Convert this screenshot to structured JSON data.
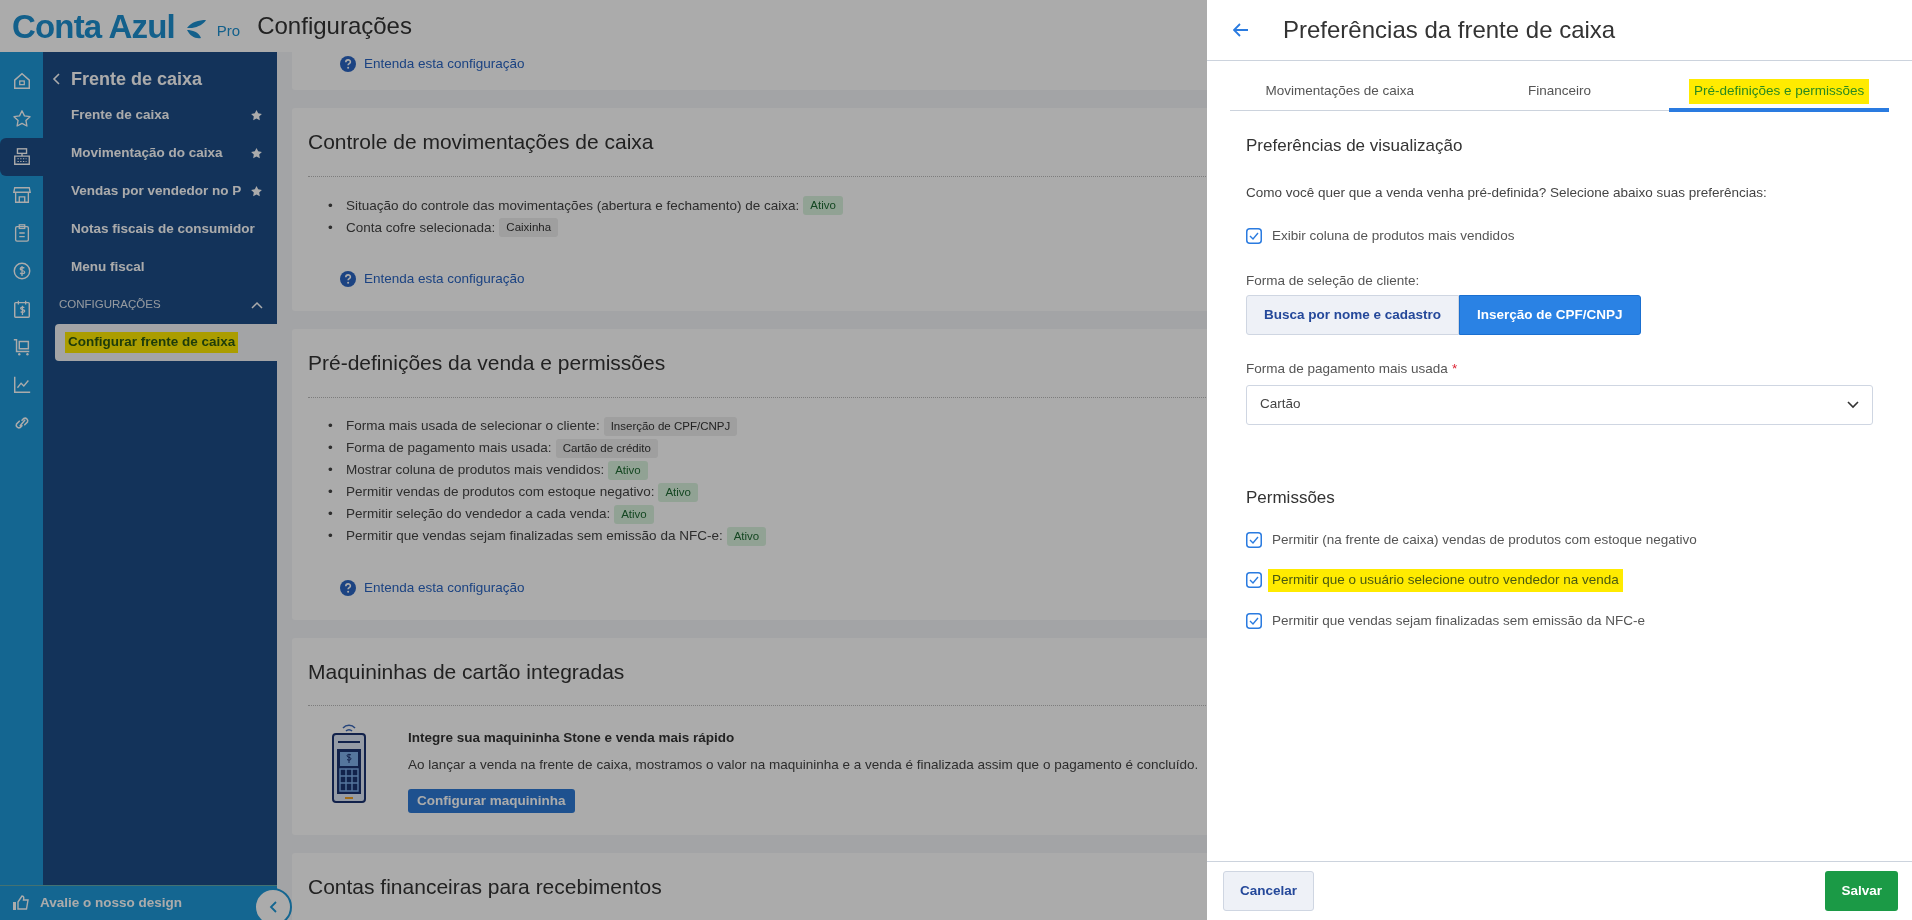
{
  "app": {
    "logo": "Conta Azul",
    "plan": "Pro",
    "page_title": "Configurações"
  },
  "rail": [
    {
      "kind": "home",
      "selected": false
    },
    {
      "kind": "star",
      "selected": false
    },
    {
      "kind": "register",
      "selected": true
    },
    {
      "kind": "store",
      "selected": false
    },
    {
      "kind": "clipboard",
      "selected": false
    },
    {
      "kind": "coin",
      "selected": false
    },
    {
      "kind": "calendar",
      "selected": false
    },
    {
      "kind": "cart",
      "selected": false
    },
    {
      "kind": "chart",
      "selected": false
    },
    {
      "kind": "link",
      "selected": false
    }
  ],
  "nav": {
    "back_title": "Frente de caixa",
    "items": [
      {
        "label": "Frente de caixa",
        "starred": true
      },
      {
        "label": "Movimentação do caixa",
        "starred": true
      },
      {
        "label": "Vendas por vendedor no P",
        "starred": true
      },
      {
        "label": "Notas fiscais de consumidor",
        "starred": false
      },
      {
        "label": "Menu fiscal",
        "starred": false
      }
    ],
    "section": {
      "label": "CONFIGURAÇÕES",
      "expanded": true,
      "items": [
        {
          "label": "Configurar frente de caixa",
          "selected": true,
          "highlighted": true
        }
      ]
    }
  },
  "feedback": {
    "label": "Avalie o nosso design"
  },
  "cards": [
    {
      "link": "Entenda esta configuração"
    },
    {
      "title": "Controle de movimentações de caixa",
      "items": [
        {
          "marker": "•",
          "text": "Situação do controle das movimentações (abertura e fechamento) de caixa:",
          "tag": {
            "label": "Ativo",
            "kind": "status"
          }
        },
        {
          "marker": "•",
          "text": "Conta cofre selecionada:",
          "tag": {
            "label": "Caixinha",
            "kind": "value"
          }
        }
      ],
      "link": "Entenda esta configuração"
    },
    {
      "title": "Pré-definições da venda e permissões",
      "items": [
        {
          "marker": "•",
          "text": "Forma mais usada de selecionar o cliente:",
          "tag": {
            "label": "Inserção de CPF/CNPJ",
            "kind": "value"
          }
        },
        {
          "marker": "•",
          "text": "Forma de pagamento mais usada:",
          "tag": {
            "label": "Cartão de crédito",
            "kind": "value"
          }
        },
        {
          "marker": "•",
          "text": "Mostrar coluna de produtos mais vendidos:",
          "tag": {
            "label": "Ativo",
            "kind": "status"
          }
        },
        {
          "marker": "•",
          "text": "Permitir vendas de produtos com estoque negativo:",
          "tag": {
            "label": "Ativo",
            "kind": "status"
          }
        },
        {
          "marker": "•",
          "text": "Permitir seleção do vendedor a cada venda:",
          "tag": {
            "label": "Ativo",
            "kind": "status"
          }
        },
        {
          "marker": "•",
          "text": "Permitir que vendas sejam finalizadas sem emissão da NFC-e:",
          "tag": {
            "label": "Ativo",
            "kind": "status"
          }
        }
      ],
      "link": "Entenda esta configuração"
    },
    {
      "title": "Maquininhas de cartão integradas",
      "promo": {
        "heading": "Integre sua maquininha Stone e venda mais rápido",
        "text": "Ao lançar a venda na frente de caixa, mostramos o valor na maquininha e a venda é finalizada assim que o pagamento é concluído.",
        "button": "Configurar maquininha"
      }
    },
    {
      "title": "Contas financeiras para recebimentos"
    }
  ],
  "panel": {
    "title": "Preferências da frente de caixa",
    "tabs": [
      {
        "label": "Movimentações de caixa",
        "selected": false,
        "highlighted": false
      },
      {
        "label": "Financeiro",
        "selected": false,
        "highlighted": false
      },
      {
        "label": "Pré-definições e permissões",
        "selected": true,
        "highlighted": true
      }
    ],
    "view_section": {
      "heading": "Preferências de visualização",
      "description": "Como você quer que a venda venha pré-definida? Selecione abaixo suas preferências:",
      "checkboxes": [
        {
          "label": "Exibir coluna de produtos mais vendidos",
          "checked": true
        }
      ],
      "client_label": "Forma de seleção de cliente:",
      "client_options": [
        {
          "label": "Busca por nome e cadastro",
          "selected": false
        },
        {
          "label": "Inserção de CPF/CNPJ",
          "selected": true
        }
      ],
      "payment": {
        "label": "Forma de pagamento mais usada",
        "required_mark": "*",
        "value": "Cartão"
      }
    },
    "permissions": {
      "heading": "Permissões",
      "checkboxes": [
        {
          "label": "Permitir (na frente de caixa) vendas de produtos com estoque negativo",
          "checked": true,
          "highlighted": false
        },
        {
          "label": "Permitir que o usuário selecione outro vendedor na venda",
          "checked": true,
          "highlighted": true
        },
        {
          "label": "Permitir que vendas sejam finalizadas sem emissão da NFC-e",
          "checked": true,
          "highlighted": false
        }
      ]
    },
    "footer": {
      "cancel": "Cancelar",
      "save": "Salvar"
    }
  }
}
